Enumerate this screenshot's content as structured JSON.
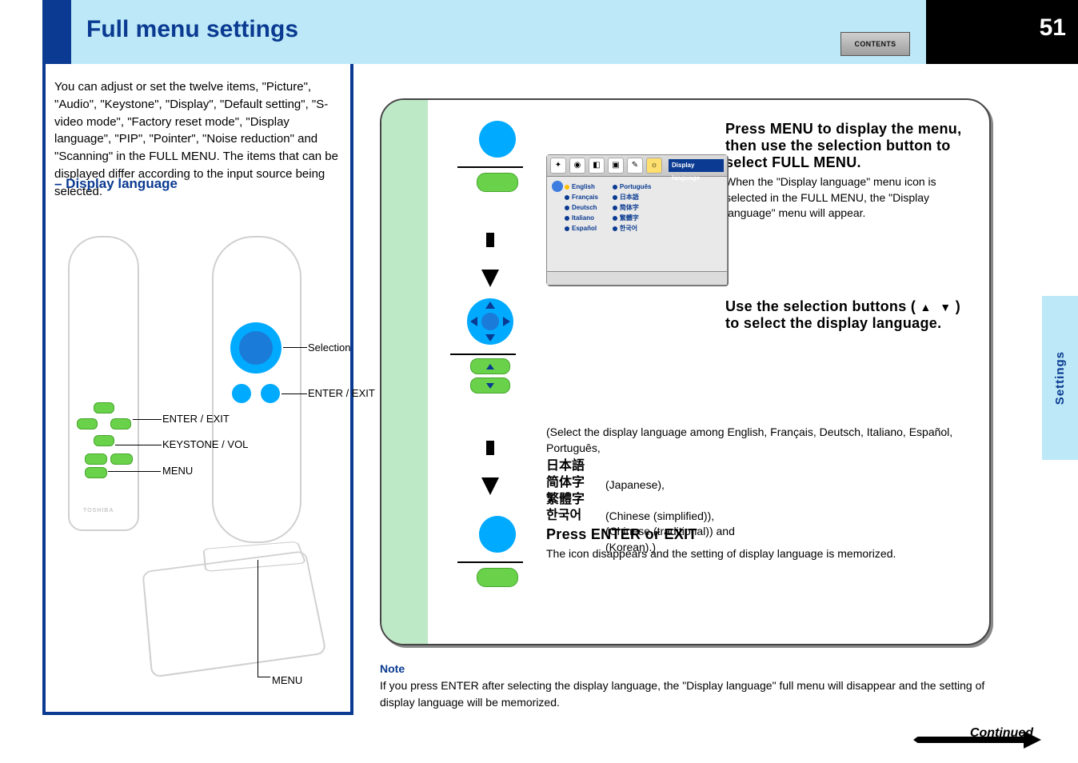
{
  "header": {
    "title": "Full menu settings",
    "page_number": "51",
    "contents_button": "CONTENTS"
  },
  "side_tab": "Settings",
  "intro_text": "You can adjust or set the twelve items, \"Picture\", \"Audio\", \"Keystone\", \"Display\", \"Default setting\", \"S-video mode\", \"Factory reset mode\", \"Display language\", \"PIP\", \"Pointer\", \"Noise reduction\" and \"Scanning\" in the FULL MENU.\nThe items that can be displayed differ according to the input source being selected.",
  "subheading": "– Display language",
  "remote_labels": {
    "enter_exit": "ENTER / EXIT",
    "menu": "MENU",
    "selection": "Selection",
    "keystone_vol": "KEYSTONE / VOL"
  },
  "steps": {
    "s1": {
      "title": "Press MENU to display the menu, then use the selection button to select FULL MENU.",
      "body": "When the \"Display language\" menu icon is selected in the FULL MENU, the \"Display language\" menu will appear."
    },
    "s2": {
      "title_a": "Use the selection buttons (",
      "title_b": ") to select the display language."
    },
    "langs": {
      "intro": "(Select the display language among English, Français, Deutsch, Italiano, Español, Português,",
      "jp": "日本語",
      "cn_s": "简体字",
      "cn_t": "繁體字",
      "kr": "한국어",
      "tail": "(Chinese (simplified)),\n(Chinese (traditional)) and\n(Korean).)",
      "jp_tail": "(Japanese),"
    },
    "s3": {
      "title": "Press ENTER or EXIT",
      "body": "The icon disappears and the setting of display language is memorized."
    }
  },
  "osd": {
    "title": "Display language",
    "col1": [
      "English",
      "Français",
      "Deutsch",
      "Italiano",
      "Español"
    ],
    "col2": [
      "Português",
      "日本語",
      "简体字",
      "繁體字",
      "한국어"
    ]
  },
  "note": {
    "head": "Note",
    "line": "If you press ENTER after selecting the display language, the \"Display language\" full menu will disappear and the setting of display language will be memorized."
  },
  "continued": "Continued",
  "brand": "TOSHIBA"
}
